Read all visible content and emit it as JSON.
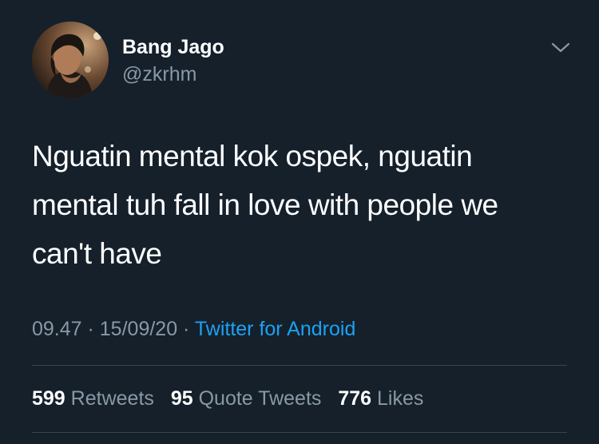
{
  "tweet": {
    "user": {
      "display_name": "Bang Jago",
      "handle": "@zkrhm"
    },
    "text": "Nguatin mental kok ospek, nguatin mental tuh fall in love with people we can't have",
    "meta": {
      "time": "09.47",
      "separator": " · ",
      "date": "15/09/20",
      "source": "Twitter for Android"
    },
    "stats": {
      "retweets": {
        "count": "599",
        "label": "Retweets"
      },
      "quote_tweets": {
        "count": "95",
        "label": "Quote Tweets"
      },
      "likes": {
        "count": "776",
        "label": "Likes"
      }
    }
  },
  "colors": {
    "background": "#15202b",
    "primary_text": "#ffffff",
    "secondary_text": "#8899a6",
    "link": "#1da1f2",
    "divider": "#38444d"
  },
  "icons": {
    "menu": "chevron-down-icon"
  }
}
